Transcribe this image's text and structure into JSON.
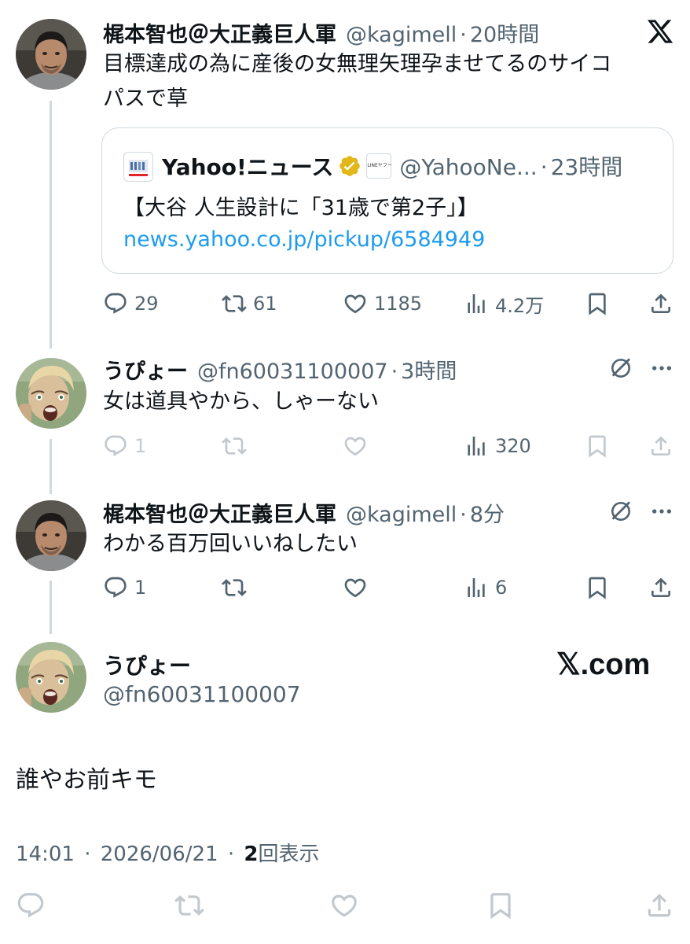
{
  "tweet1": {
    "name": "梶本智也＠大正義巨人軍",
    "handle": "@kagimell",
    "time": "20時間",
    "text_line1": "目標達成の為に産後の女無理矢理孕ませてるのサイコ",
    "text_line2": "パスで草",
    "quote": {
      "name": "Yahoo!ニュース",
      "badge_text": "LINEヤフー",
      "handle": "@YahooNe...",
      "time": "23時間",
      "title": "【大谷 人生設計に「31歳で第2子」】",
      "link": "news.yahoo.co.jp/pickup/6584949"
    },
    "replies": "29",
    "retweets": "61",
    "likes": "1185",
    "views": "4.2万"
  },
  "tweet2": {
    "name": "うぴょー",
    "handle": "@fn60031100007",
    "time": "3時間",
    "text": "女は道具やから、しゃーない",
    "replies": "1",
    "views": "320"
  },
  "tweet3": {
    "name": "梶本智也＠大正義巨人軍",
    "handle": "@kagimell",
    "time": "8分",
    "text": "わかる百万回いいねしたい",
    "replies": "1",
    "views": "6"
  },
  "main": {
    "name": "うぴょー",
    "handle": "@fn60031100007",
    "watermark": "𝕏.com",
    "text": "誰やお前キモ",
    "time": "14:01",
    "date": "2026/06/21",
    "views_count": "2",
    "views_label": "回表示"
  },
  "icons": [
    "x-logo-icon",
    "reply-icon",
    "retweet-icon",
    "like-icon",
    "views-icon",
    "bookmark-icon",
    "share-icon",
    "grok-icon",
    "more-icon",
    "verified-gold-icon"
  ],
  "colors": {
    "text": "#0f1419",
    "secondary": "#536471",
    "link": "#1d9bf0",
    "border": "#cfd9de",
    "verified": "#e2b719"
  }
}
